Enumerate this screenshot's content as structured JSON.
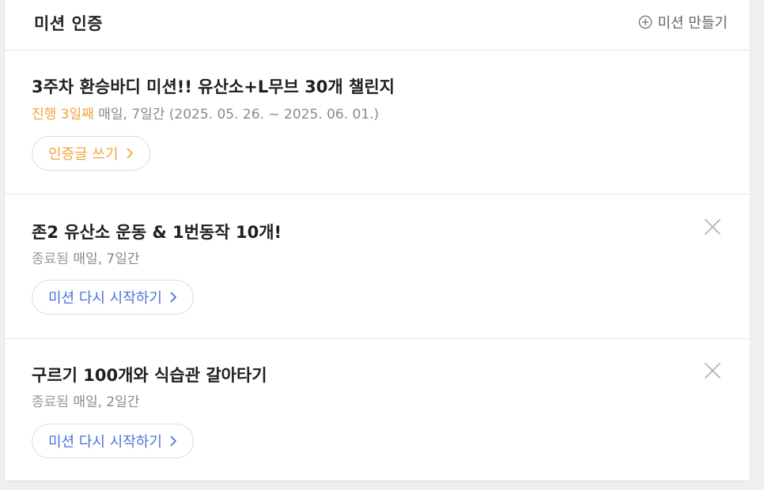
{
  "header": {
    "title": "미션 인증",
    "create_label": "미션 만들기"
  },
  "missions": [
    {
      "title": "3주차 환승바디 미션!! 유산소+L무브 30개 챌린지",
      "status": "진행 3일째",
      "schedule": "매일, 7일간 (2025. 05. 26. ~ 2025. 06. 01.)",
      "action_label": "인증글 쓰기",
      "closable": false
    },
    {
      "title": "존2 유산소 운동 & 1번동작 10개!",
      "status": "종료됨",
      "schedule": "매일, 7일간",
      "action_label": "미션 다시 시작하기",
      "closable": true
    },
    {
      "title": "구르기 100개와 식습관 갈아타기",
      "status": "종료됨",
      "schedule": "매일, 2일간",
      "action_label": "미션 다시 시작하기",
      "closable": true
    }
  ],
  "colors": {
    "active": "#f0a63a",
    "restart": "#4f72db",
    "ended": "#9a9a9a"
  },
  "icons": {
    "create": "plus-circle-icon",
    "chevron": "chevron-right-icon",
    "close": "close-icon"
  }
}
